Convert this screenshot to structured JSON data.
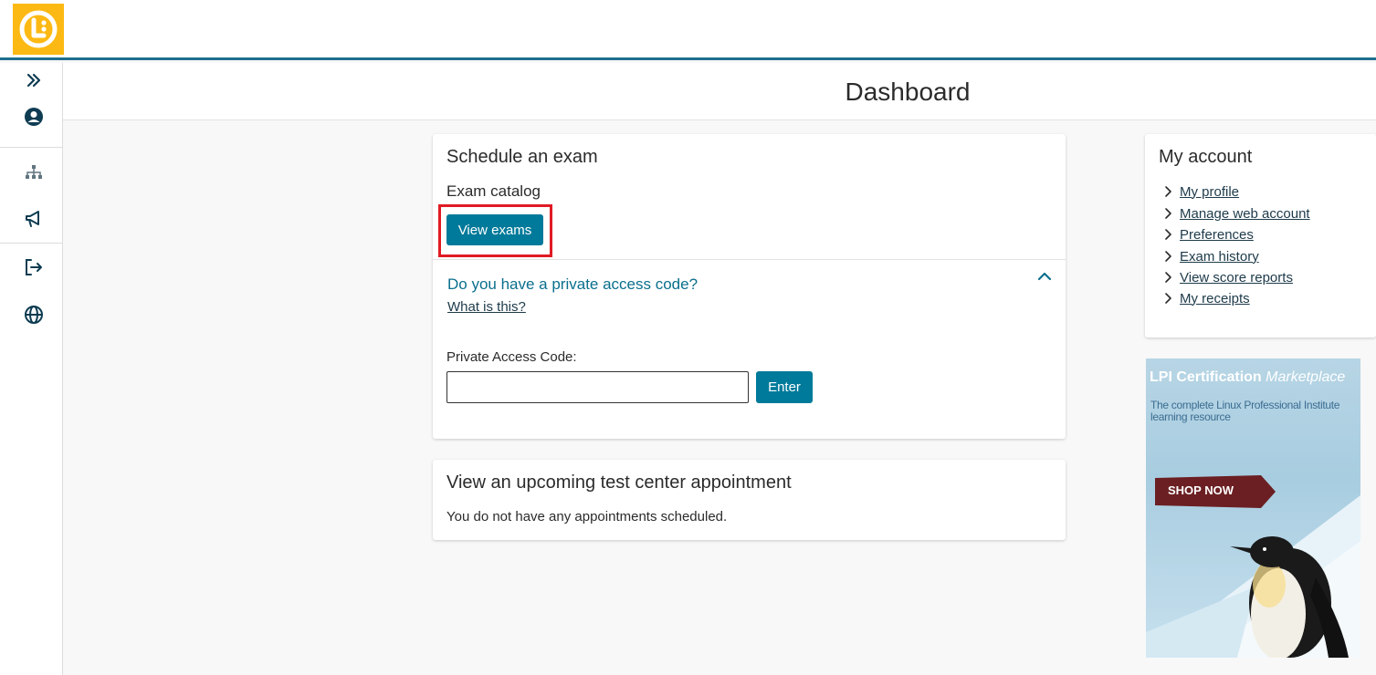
{
  "header": {
    "logo_icon": "lpi-logo-icon",
    "accent_color": "#fdb913",
    "bar_color": "#1e6e8e"
  },
  "rail": {
    "icons": [
      "expand-chevrons-icon",
      "user-circle-icon",
      "sitemap-icon",
      "megaphone-icon",
      "sign-out-icon",
      "globe-icon"
    ]
  },
  "page": {
    "title": "Dashboard"
  },
  "schedule": {
    "title": "Schedule an exam",
    "catalog_label": "Exam catalog",
    "view_button": "View exams",
    "private_question": "Do you have a private access code?",
    "what_link": "What is this?",
    "code_label": "Private Access Code:",
    "code_value": "",
    "enter_button": "Enter"
  },
  "appointment": {
    "title": "View an upcoming test center appointment",
    "message": "You do not have any appointments scheduled."
  },
  "account": {
    "title": "My account",
    "links": [
      "My profile",
      "Manage web account",
      "Preferences",
      "Exam history",
      "View score reports",
      "My receipts"
    ]
  },
  "ad": {
    "title_bold": "LPI Certification",
    "title_italic": "Marketplace",
    "subtitle": "The complete Linux Professional Institute learning resource",
    "shop_label": "SHOP NOW"
  },
  "colors": {
    "primary_button": "#007a9a",
    "link_teal": "#0b6f8d"
  }
}
